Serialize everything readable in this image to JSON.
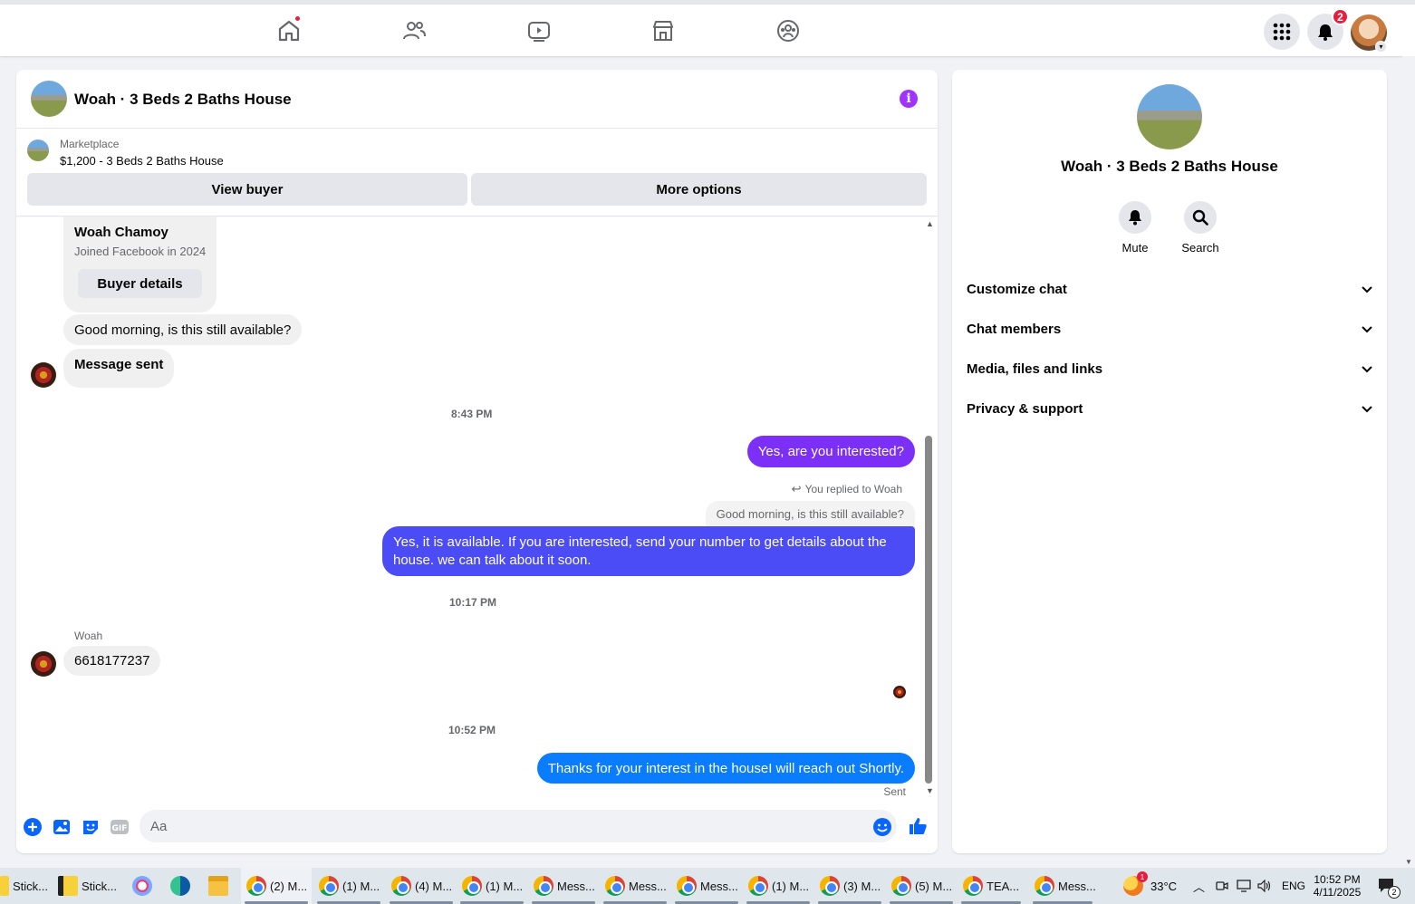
{
  "topnav": {
    "icons": [
      "home-icon",
      "friends-icon",
      "watch-icon",
      "marketplace-icon",
      "groups-icon"
    ],
    "notifications_count": "2",
    "menu_icon": "grid-menu-icon"
  },
  "chat": {
    "title": "Woah · 3 Beds 2 Baths House",
    "marketplace_label": "Marketplace",
    "listing": "$1,200 - 3 Beds 2 Baths House",
    "view_buyer": "View buyer",
    "more_options": "More options",
    "buyer_card": {
      "name": "Woah Chamoy",
      "joined": "Joined Facebook in 2024",
      "details_button": "Buyer details"
    },
    "messages": {
      "in_1": "Good morning, is this still available?",
      "in_2": "Message sent",
      "time_1": "8:43 PM",
      "out_1": "Yes, are you interested?",
      "reply_note": "You replied to Woah",
      "quoted": "Good morning, is this still available?",
      "out_2": "Yes, it is available. If you are interested, send your number to get details about the house. we can talk about it soon.",
      "time_2": "10:17 PM",
      "sender_name": "Woah",
      "in_3": "6618177237",
      "time_3": "10:52 PM",
      "out_3": "Thanks for your interest in the houseI will reach out Shortly.",
      "status": "Sent"
    },
    "composer_placeholder": "Aa",
    "colors": {
      "out_purple": "#7b2ff7",
      "out_blue_purple": "#4b4cf5",
      "out_blue": "#0a7cff"
    }
  },
  "info": {
    "title": "Woah · 3 Beds 2 Baths House",
    "mute": "Mute",
    "search": "Search",
    "sections": [
      "Customize chat",
      "Chat members",
      "Media, files and links",
      "Privacy & support"
    ]
  },
  "taskbar": {
    "items": [
      "Stick...",
      "Stick...",
      "(2) M...",
      "(1) M...",
      "(4) M...",
      "(1) M...",
      "Mess...",
      "Mess...",
      "Mess...",
      "(1) M...",
      "(3) M...",
      "(5) M...",
      "TEA...",
      "Mess..."
    ],
    "weather": "33°C",
    "lang": "ENG",
    "time": "10:52 PM",
    "date": "4/11/2025",
    "notif_count": "2"
  }
}
